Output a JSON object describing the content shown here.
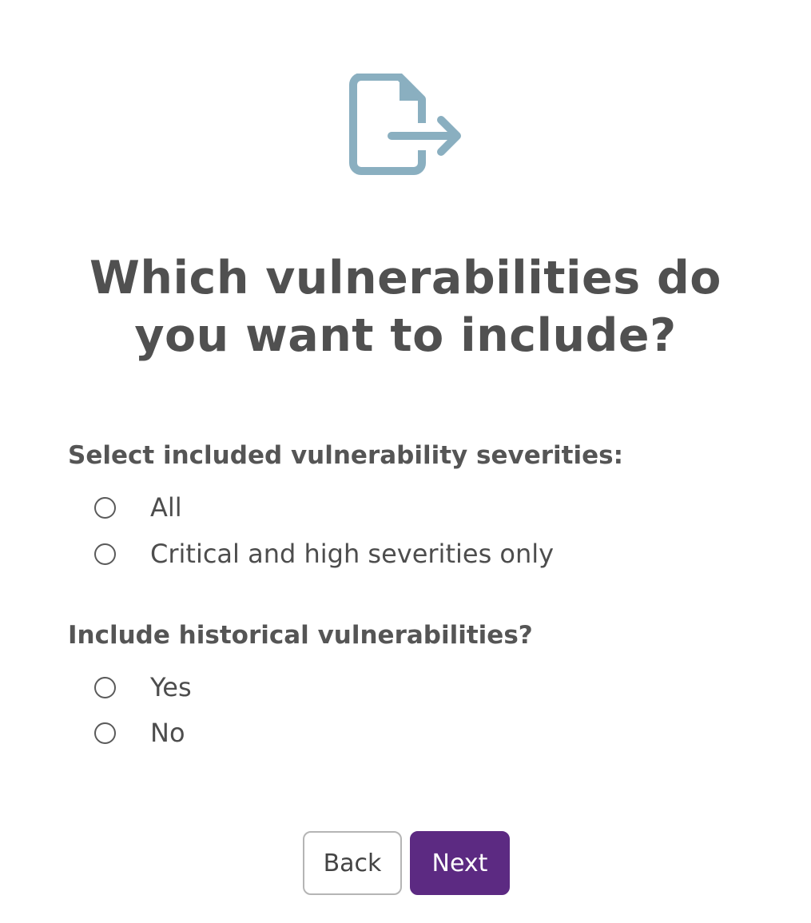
{
  "header": {
    "icon": "file-export-icon",
    "icon_color": "#8aafc0",
    "title": "Which vulnerabilities do you want to include?"
  },
  "severities": {
    "label": "Select included vulnerability severities:",
    "options": [
      {
        "label": "All",
        "selected": false
      },
      {
        "label": "Critical and high severities only",
        "selected": false
      }
    ]
  },
  "historical": {
    "label": "Include historical vulnerabilities?",
    "options": [
      {
        "label": "Yes",
        "selected": false
      },
      {
        "label": "No",
        "selected": false
      }
    ]
  },
  "footer": {
    "back_label": "Back",
    "next_label": "Next",
    "next_color": "#5c2a82"
  }
}
